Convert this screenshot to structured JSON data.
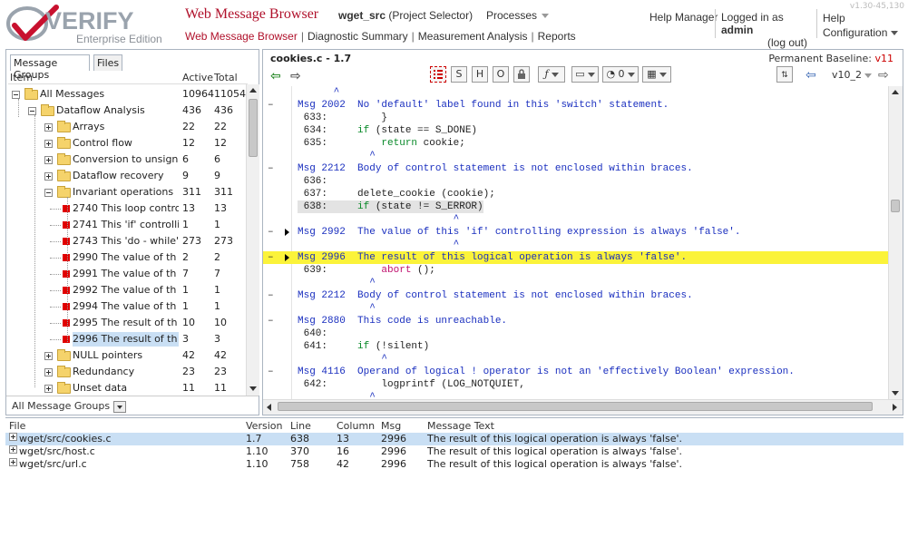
{
  "header": {
    "version": "v1.30-45,130",
    "logo_brand": "VERIFY",
    "logo_edition": "Enterprise Edition",
    "app_title": "Web Message Browser",
    "project": "wget_src",
    "project_suffix": "(Project Selector)",
    "processes": "Processes",
    "nav": [
      "Web Message Browser",
      "Diagnostic Summary",
      "Measurement Analysis",
      "Reports"
    ],
    "help_manager": "Help Manager",
    "logged_in_prefix": "Logged in as",
    "user": "admin",
    "logout": "(log out)",
    "help": "Help",
    "configuration": "Configuration"
  },
  "left": {
    "tabs": [
      "Message Groups",
      "Files"
    ],
    "columns": [
      "Item",
      "Active",
      "Total"
    ],
    "group_selector": "All Message Groups",
    "tree": [
      {
        "label": "All Messages",
        "active": "10964",
        "total": "11054",
        "level": 0,
        "kind": "folder",
        "exp": "minus"
      },
      {
        "label": "Dataflow Analysis",
        "active": "436",
        "total": "436",
        "level": 1,
        "kind": "folder",
        "exp": "minus"
      },
      {
        "label": "Arrays",
        "active": "22",
        "total": "22",
        "level": 2,
        "kind": "folder",
        "exp": "plus"
      },
      {
        "label": "Control flow",
        "active": "12",
        "total": "12",
        "level": 2,
        "kind": "folder",
        "exp": "plus"
      },
      {
        "label": "Conversion to unsigned",
        "active": "6",
        "total": "6",
        "level": 2,
        "kind": "folder",
        "exp": "plus"
      },
      {
        "label": "Dataflow recovery",
        "active": "9",
        "total": "9",
        "level": 2,
        "kind": "folder",
        "exp": "plus"
      },
      {
        "label": "Invariant operations",
        "active": "311",
        "total": "311",
        "level": 2,
        "kind": "folder",
        "exp": "minus"
      },
      {
        "label": "2740 This loop contro",
        "active": "13",
        "total": "13",
        "level": 3,
        "kind": "msg"
      },
      {
        "label": "2741 This 'if' controllir",
        "active": "1",
        "total": "1",
        "level": 3,
        "kind": "msg"
      },
      {
        "label": "2743 This 'do - while'",
        "active": "273",
        "total": "273",
        "level": 3,
        "kind": "msg"
      },
      {
        "label": "2990 The value of th",
        "active": "2",
        "total": "2",
        "level": 3,
        "kind": "msg"
      },
      {
        "label": "2991 The value of th",
        "active": "7",
        "total": "7",
        "level": 3,
        "kind": "msg"
      },
      {
        "label": "2992 The value of th",
        "active": "1",
        "total": "1",
        "level": 3,
        "kind": "msg"
      },
      {
        "label": "2994 The value of th",
        "active": "1",
        "total": "1",
        "level": 3,
        "kind": "msg"
      },
      {
        "label": "2995 The result of th",
        "active": "10",
        "total": "10",
        "level": 3,
        "kind": "msg"
      },
      {
        "label": "2996 The result of th",
        "active": "3",
        "total": "3",
        "level": 3,
        "kind": "msg",
        "selected": true
      },
      {
        "label": "NULL pointers",
        "active": "42",
        "total": "42",
        "level": 2,
        "kind": "folder",
        "exp": "plus"
      },
      {
        "label": "Redundancy",
        "active": "23",
        "total": "23",
        "level": 2,
        "kind": "folder",
        "exp": "plus"
      },
      {
        "label": "Unset data",
        "active": "11",
        "total": "11",
        "level": 2,
        "kind": "folder",
        "exp": "plus"
      }
    ]
  },
  "right": {
    "file_title": "cookies.c - 1.7",
    "baseline_label": "Permanent Baseline:",
    "baseline_value": "v11",
    "toolbar": {
      "s": "S",
      "h": "H",
      "o": "O",
      "count": "0",
      "version": "v10_2"
    },
    "code_lines": [
      {
        "marker": "",
        "tri": false,
        "kind": "caret",
        "text": "      ^"
      },
      {
        "marker": "–",
        "tri": false,
        "kind": "msg",
        "text": "Msg 2002  No 'default' label found in this 'switch' statement."
      },
      {
        "marker": "",
        "tri": false,
        "kind": "code",
        "text": " 633:         }"
      },
      {
        "marker": "",
        "tri": false,
        "kind": "code",
        "text": " 634:     if (state == S_DONE)"
      },
      {
        "marker": "",
        "tri": false,
        "kind": "code",
        "text": " 635:         return cookie;"
      },
      {
        "marker": "",
        "tri": false,
        "kind": "caret",
        "text": "            ^"
      },
      {
        "marker": "–",
        "tri": false,
        "kind": "msg",
        "text": "Msg 2212  Body of control statement is not enclosed within braces."
      },
      {
        "marker": "",
        "tri": false,
        "kind": "code",
        "text": " 636:"
      },
      {
        "marker": "",
        "tri": false,
        "kind": "code",
        "text": " 637:     delete_cookie (cookie);"
      },
      {
        "marker": "",
        "tri": false,
        "kind": "code",
        "text": " 638:     if (state != S_ERROR)",
        "hl": "g"
      },
      {
        "marker": "",
        "tri": false,
        "kind": "caret",
        "text": "                          ^"
      },
      {
        "marker": "–",
        "tri": true,
        "kind": "msg",
        "text": "Msg 2992  The value of this 'if' controlling expression is always 'false'."
      },
      {
        "marker": "",
        "tri": false,
        "kind": "caret",
        "text": "                          ^"
      },
      {
        "marker": "–",
        "tri": true,
        "kind": "msg",
        "text": "Msg 2996  The result of this logical operation is always 'false'.",
        "hl": "y"
      },
      {
        "marker": "",
        "tri": false,
        "kind": "code",
        "text": " 639:         abort ();"
      },
      {
        "marker": "",
        "tri": false,
        "kind": "caret",
        "text": "            ^"
      },
      {
        "marker": "–",
        "tri": false,
        "kind": "msg",
        "text": "Msg 2212  Body of control statement is not enclosed within braces."
      },
      {
        "marker": "",
        "tri": false,
        "kind": "caret",
        "text": "            ^"
      },
      {
        "marker": "–",
        "tri": false,
        "kind": "msg",
        "text": "Msg 2880  This code is unreachable."
      },
      {
        "marker": "",
        "tri": false,
        "kind": "code",
        "text": " 640:"
      },
      {
        "marker": "",
        "tri": false,
        "kind": "code",
        "text": " 641:     if (!silent)"
      },
      {
        "marker": "",
        "tri": false,
        "kind": "caret",
        "text": "              ^"
      },
      {
        "marker": "–",
        "tri": false,
        "kind": "msg",
        "text": "Msg 4116  Operand of logical ! operator is not an 'effectively Boolean' expression."
      },
      {
        "marker": "",
        "tri": false,
        "kind": "code",
        "text": " 642:         logprintf (LOG_NOTQUIET,"
      },
      {
        "marker": "",
        "tri": false,
        "kind": "caret",
        "text": "            ^"
      }
    ]
  },
  "bottom": {
    "columns": [
      "File",
      "Version",
      "Line",
      "Column",
      "Msg",
      "Message Text"
    ],
    "rows": [
      {
        "file": "wget/src/cookies.c",
        "version": "1.7",
        "line": "638",
        "column": "13",
        "msg": "2996",
        "text": "The result of this logical operation is always 'false'.",
        "selected": true
      },
      {
        "file": "wget/src/host.c",
        "version": "1.10",
        "line": "370",
        "column": "16",
        "msg": "2996",
        "text": "The result of this logical operation is always 'false'.",
        "selected": false
      },
      {
        "file": "wget/src/url.c",
        "version": "1.10",
        "line": "758",
        "column": "42",
        "msg": "2996",
        "text": "The result of this logical operation is always 'false'.",
        "selected": false
      }
    ]
  },
  "colors": {
    "accent": "#b0112b",
    "selection": "#c9dff4",
    "highlight": "#fbf33a",
    "message_blue": "#1a2fbf",
    "keyword_green": "#0a8a2a"
  }
}
